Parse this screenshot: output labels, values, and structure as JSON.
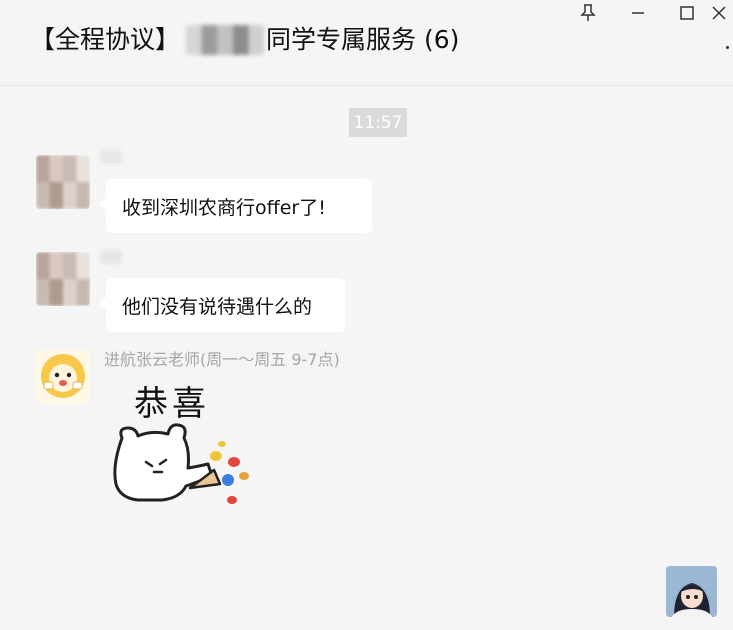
{
  "window": {
    "title_prefix": "【全程协议】",
    "title_suffix": "同学专属服务 (6)"
  },
  "controls": {
    "pin_icon": "pin-icon",
    "minimize_icon": "minimize-icon",
    "maximize_icon": "maximize-icon",
    "close_icon": "close-icon"
  },
  "chat": {
    "time": "11:57",
    "messages": [
      {
        "text": "收到深圳农商行offer了!"
      },
      {
        "text": "他们没有说待遇什么的"
      }
    ],
    "teacher": {
      "name": "进航张云老师(周一～周五 9-7点)",
      "sticker_text": "恭喜"
    }
  }
}
